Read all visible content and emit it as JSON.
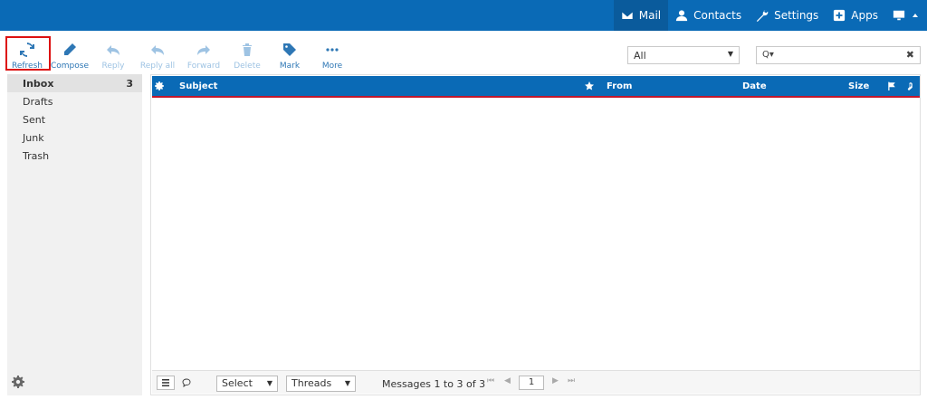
{
  "topnav": {
    "mail": "Mail",
    "contacts": "Contacts",
    "settings": "Settings",
    "apps": "Apps"
  },
  "toolbar": {
    "refresh": "Refresh",
    "compose": "Compose",
    "reply": "Reply",
    "reply_all": "Reply all",
    "forward": "Forward",
    "delete": "Delete",
    "mark": "Mark",
    "more": "More"
  },
  "filter": {
    "value": "All"
  },
  "folders": [
    {
      "label": "Inbox",
      "count": "3"
    },
    {
      "label": "Drafts"
    },
    {
      "label": "Sent"
    },
    {
      "label": "Junk"
    },
    {
      "label": "Trash"
    }
  ],
  "list_header": {
    "subject": "Subject",
    "from": "From",
    "date": "Date",
    "size": "Size"
  },
  "footer": {
    "select": "Select",
    "threads": "Threads",
    "count_text": "Messages 1 to 3 of 3",
    "page": "1"
  },
  "colors": {
    "brand": "#0a6ab6",
    "accent": "#c0172b"
  }
}
